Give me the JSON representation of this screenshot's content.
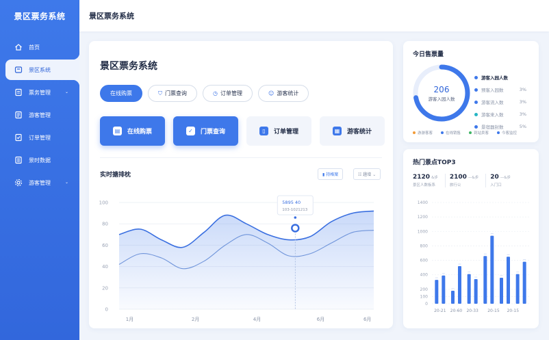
{
  "brand": "景区票务系统",
  "topbar_title": "景区票务系统",
  "sidebar": {
    "items": [
      {
        "label": "首页",
        "icon": "home-icon"
      },
      {
        "label": "景区系统",
        "icon": "ticket-icon",
        "active": true
      },
      {
        "label": "票务管理",
        "icon": "document-icon",
        "chevron": true
      },
      {
        "label": "游客管理",
        "icon": "list-icon"
      },
      {
        "label": "订单管理",
        "icon": "check-doc-icon"
      },
      {
        "label": "景时数据",
        "icon": "data-icon"
      },
      {
        "label": "游客管理",
        "icon": "gear-icon",
        "chevron": true
      }
    ]
  },
  "main": {
    "title": "景区票务系统",
    "pills": [
      {
        "label": "在线购票",
        "active": true
      },
      {
        "label": "门票查询",
        "icon": "shield-icon"
      },
      {
        "label": "订单管理",
        "icon": "clock-icon"
      },
      {
        "label": "游客统计",
        "icon": "smile-icon"
      }
    ],
    "big_buttons": [
      {
        "label": "在线购票",
        "icon": "cart-icon",
        "primary": true
      },
      {
        "label": "门票查询",
        "icon": "check-icon",
        "primary": true
      },
      {
        "label": "订单管理",
        "icon": "clipboard-icon"
      },
      {
        "label": "游客统计",
        "icon": "calendar-icon"
      }
    ],
    "chart_title": "实时搪排枕",
    "chart_btn1": "▮ 持格案",
    "chart_btn2": "☷ 趣增 ⌄"
  },
  "today": {
    "title": "今日售票量",
    "center_value": "206",
    "center_label": "游客入园人数",
    "legend": [
      {
        "label": "游客入园人数",
        "value": "",
        "color": "#3e78ea",
        "bold": true
      },
      {
        "label": "预客入园数",
        "value": "3%",
        "color": "#3e78ea"
      },
      {
        "label": "游客流入数",
        "value": "3%",
        "color": "#3e78ea"
      },
      {
        "label": "游客来入数",
        "value": "3%",
        "color": "#26b5c4"
      },
      {
        "label": "景宿器封数",
        "value": "5%",
        "color": "#3e78ea"
      }
    ],
    "bottom_legend": [
      {
        "label": "游游客客",
        "color": "#f29b38"
      },
      {
        "label": "在线销售",
        "color": "#3e78ea"
      },
      {
        "label": "到站卖客",
        "color": "#3fb565"
      },
      {
        "label": "今客监控",
        "color": "#3e78ea"
      }
    ]
  },
  "hot": {
    "title": "热门景点TOP3",
    "stats": [
      {
        "value": "2120",
        "unit": "&步",
        "label": "景区人数板系"
      },
      {
        "value": "2100",
        "unit": "—&步",
        "label": "旅行公"
      },
      {
        "value": "20",
        "unit": "—&步",
        "label": "入门口"
      }
    ]
  },
  "chart_data": [
    {
      "type": "area",
      "title": "实时搪排枕",
      "x_ticks": [
        "1月",
        "2月",
        "4月",
        "6月",
        "6月"
      ],
      "ylim": [
        0,
        100
      ],
      "y_ticks": [
        0,
        20,
        40,
        60,
        80,
        100
      ],
      "series": [
        {
          "x": [
            0,
            1,
            2,
            3,
            4,
            5,
            6,
            7,
            8,
            9,
            10,
            11,
            12
          ],
          "values": [
            70,
            75,
            65,
            58,
            72,
            88,
            80,
            70,
            65,
            68,
            82,
            90,
            92
          ]
        },
        {
          "x": [
            0,
            1,
            2,
            3,
            4,
            5,
            6,
            7,
            8,
            9,
            10,
            11,
            12
          ],
          "values": [
            42,
            52,
            48,
            38,
            45,
            60,
            70,
            62,
            50,
            52,
            62,
            72,
            74
          ]
        }
      ],
      "tooltip": {
        "line1": "5895 40",
        "line2": "103-1021213",
        "x": 8.3,
        "y": 76
      },
      "grid": true
    },
    {
      "type": "bar",
      "title": "热门景点TOP3",
      "ylim": [
        0,
        1400
      ],
      "y_ticks": [
        0,
        100,
        200,
        400,
        600,
        800,
        1000,
        1200,
        1400
      ],
      "x_ticks": [
        "20-21",
        "20-60",
        "20-33",
        "20-15",
        "20-15"
      ],
      "values": [
        330,
        390,
        180,
        520,
        410,
        340,
        660,
        940,
        360,
        650,
        410,
        580
      ]
    }
  ]
}
